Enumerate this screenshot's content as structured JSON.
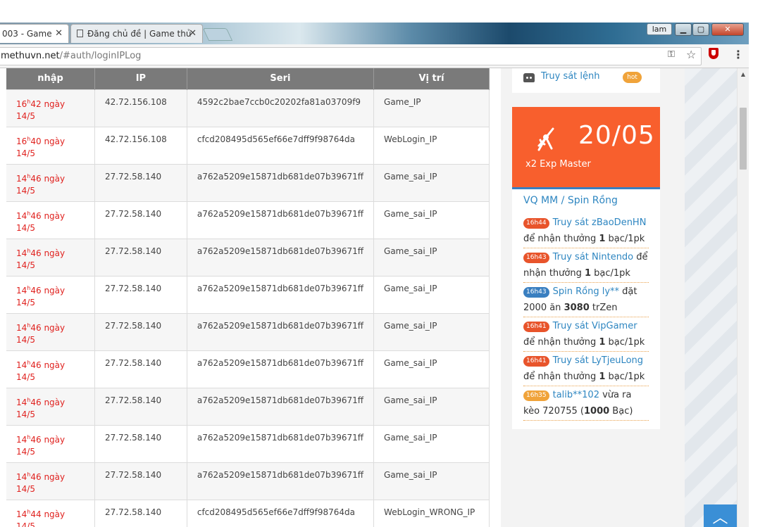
{
  "browser": {
    "tabs": [
      {
        "label": "003 - Game"
      },
      {
        "label": "Đăng chủ đề | Game thủ"
      }
    ],
    "profile_label": "lam",
    "url_host": "methuvn.net",
    "url_path": "/#auth/loginIPLog"
  },
  "table": {
    "headers": [
      "nhập",
      "IP",
      "Seri",
      "Vị trí"
    ],
    "rows": [
      {
        "hour": "16",
        "rest": "42 ngày",
        "date": "14/5",
        "ip": "42.72.156.108",
        "seri": "4592c2bae7ccb0c20202fa81a03709f9",
        "location": "Game_IP"
      },
      {
        "hour": "16",
        "rest": "40 ngày",
        "date": "14/5",
        "ip": "42.72.156.108",
        "seri": "cfcd208495d565ef66e7dff9f98764da",
        "location": "WebLogin_IP"
      },
      {
        "hour": "14",
        "rest": "46 ngày",
        "date": "14/5",
        "ip": "27.72.58.140",
        "seri": "a762a5209e15871db681de07b39671ff",
        "location": "Game_sai_IP"
      },
      {
        "hour": "14",
        "rest": "46 ngày",
        "date": "14/5",
        "ip": "27.72.58.140",
        "seri": "a762a5209e15871db681de07b39671ff",
        "location": "Game_sai_IP"
      },
      {
        "hour": "14",
        "rest": "46 ngày",
        "date": "14/5",
        "ip": "27.72.58.140",
        "seri": "a762a5209e15871db681de07b39671ff",
        "location": "Game_sai_IP"
      },
      {
        "hour": "14",
        "rest": "46 ngày",
        "date": "14/5",
        "ip": "27.72.58.140",
        "seri": "a762a5209e15871db681de07b39671ff",
        "location": "Game_sai_IP"
      },
      {
        "hour": "14",
        "rest": "46 ngày",
        "date": "14/5",
        "ip": "27.72.58.140",
        "seri": "a762a5209e15871db681de07b39671ff",
        "location": "Game_sai_IP"
      },
      {
        "hour": "14",
        "rest": "46 ngày",
        "date": "14/5",
        "ip": "27.72.58.140",
        "seri": "a762a5209e15871db681de07b39671ff",
        "location": "Game_sai_IP"
      },
      {
        "hour": "14",
        "rest": "46 ngày",
        "date": "14/5",
        "ip": "27.72.58.140",
        "seri": "a762a5209e15871db681de07b39671ff",
        "location": "Game_sai_IP"
      },
      {
        "hour": "14",
        "rest": "46 ngày",
        "date": "14/5",
        "ip": "27.72.58.140",
        "seri": "a762a5209e15871db681de07b39671ff",
        "location": "Game_sai_IP"
      },
      {
        "hour": "14",
        "rest": "46 ngày",
        "date": "14/5",
        "ip": "27.72.58.140",
        "seri": "a762a5209e15871db681de07b39671ff",
        "location": "Game_sai_IP"
      },
      {
        "hour": "14",
        "rest": "44 ngày",
        "date": "14/5",
        "ip": "27.72.58.140",
        "seri": "cfcd208495d565ef66e7dff9f98764da",
        "location": "WebLogin_WRONG_IP"
      }
    ]
  },
  "sidebar": {
    "top_link": "Truy sát lệnh",
    "hot_badge": "hot",
    "promo": {
      "date": "20/05",
      "subtitle": "x2 Exp Master"
    },
    "news_title": "VQ MM / Spin Rồng",
    "news": [
      {
        "time": "16h44",
        "badge_color": "#e8542b",
        "link": "Truy sát zBaoDenHN",
        "before_bold": " để nhận thưởng ",
        "bold": "1",
        "after_bold": " bạc/1pk"
      },
      {
        "time": "16h43",
        "badge_color": "#e8542b",
        "link": "Truy sát Nintendo",
        "before_bold": " để nhận thưởng ",
        "bold": "1",
        "after_bold": " bạc/1pk"
      },
      {
        "time": "16h43",
        "badge_color": "#3a7fc0",
        "link": "Spin Rồng ly**",
        "before_bold": " đặt 2000 ăn ",
        "bold": "3080",
        "after_bold": " trZen"
      },
      {
        "time": "16h41",
        "badge_color": "#e8542b",
        "link": "Truy sát VipGamer",
        "before_bold": " để nhận thưởng ",
        "bold": "1",
        "after_bold": " bạc/1pk"
      },
      {
        "time": "16h41",
        "badge_color": "#e8542b",
        "link": "Truy sát LyTjeuLong",
        "before_bold": " để nhận thưởng ",
        "bold": "1",
        "after_bold": " bạc/1pk"
      },
      {
        "time": "16h35",
        "badge_color": "#f0a33a",
        "link": "talib**102",
        "before_bold": " vừa ra kèo 720755 (",
        "bold": "1000",
        "after_bold": " Bạc)"
      }
    ]
  },
  "icons": {
    "key": "key-icon",
    "star": "star-icon",
    "shield": "shield-icon",
    "menu": "menu-icon",
    "scroll_top": "chevron-up-icon"
  }
}
